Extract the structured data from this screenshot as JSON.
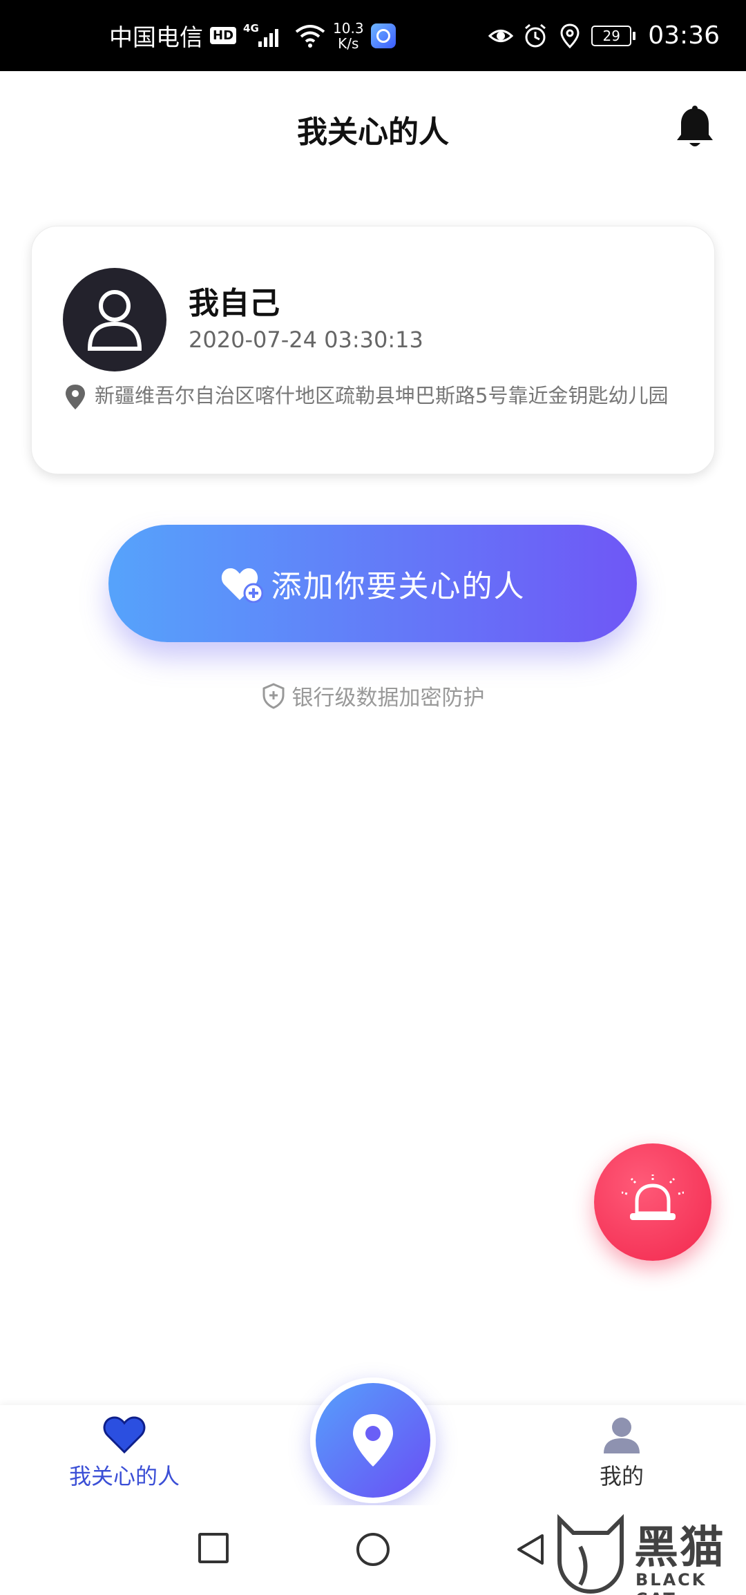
{
  "status_bar": {
    "carrier": "中国电信",
    "hd_badge": "HD",
    "network_tag": "4G",
    "speed_value": "10.3",
    "speed_unit": "K/s",
    "battery": "29",
    "time": "03:36"
  },
  "header": {
    "title": "我关心的人"
  },
  "self_card": {
    "name": "我自己",
    "timestamp": "2020-07-24 03:30:13",
    "address": "新疆维吾尔自治区喀什地区疏勒县坤巴斯路5号靠近金钥匙幼儿园"
  },
  "add_button": {
    "label": "添加你要关心的人"
  },
  "security_note": "银行级数据加密防护",
  "bottom_nav": {
    "left_label": "我关心的人",
    "right_label": "我的"
  },
  "watermark": {
    "cn": "黑猫",
    "en": "BLACK CAT"
  },
  "colors": {
    "accent_blue": "#56a3fb",
    "accent_purple": "#6f57f6",
    "sos_red": "#f2284e",
    "nav_active": "#3b4fd6"
  }
}
